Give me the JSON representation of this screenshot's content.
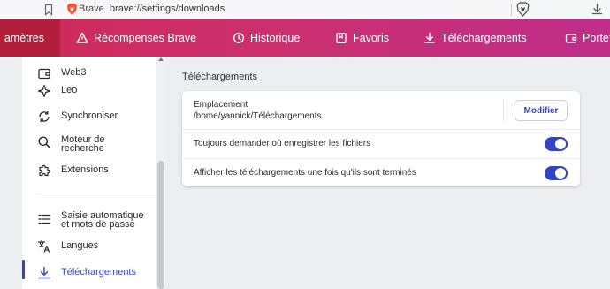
{
  "addressbar": {
    "brave_label": "Brave",
    "url": "brave://settings/downloads"
  },
  "tabs": [
    {
      "label": "amètres",
      "icon": "gear-icon",
      "active": true
    },
    {
      "label": "Récompenses Brave",
      "icon": "rewards-triangle-icon"
    },
    {
      "label": "Historique",
      "icon": "history-icon"
    },
    {
      "label": "Favoris",
      "icon": "bookmarks-icon"
    },
    {
      "label": "Téléchargements",
      "icon": "download-icon"
    },
    {
      "label": "Portef",
      "icon": "wallet-icon"
    }
  ],
  "sidebar": {
    "items": [
      {
        "label": "Web3",
        "icon": "wallet-icon"
      },
      {
        "label": "Leo",
        "icon": "sparkle-icon"
      },
      {
        "label": "Synchroniser",
        "icon": "sync-icon"
      },
      {
        "label": "Moteur de",
        "label2": "recherche",
        "icon": "search-icon"
      },
      {
        "label": "Extensions",
        "icon": "puzzle-icon"
      },
      {
        "label": "Saisie automatique",
        "label2": "et mots de passe",
        "icon": "autofill-list-icon"
      },
      {
        "label": "Langues",
        "icon": "translate-icon"
      },
      {
        "label": "Téléchargements",
        "icon": "download-icon",
        "active": true
      }
    ]
  },
  "main": {
    "section_title": "Téléchargements",
    "location_label": "Emplacement",
    "location_path": "/home/yannick/Téléchargements",
    "modify_button": "Modifier",
    "settings": [
      {
        "label": "Toujours demander où enregistrer les fichiers",
        "enabled": true
      },
      {
        "label": "Afficher les téléchargements une fois qu'ils sont terminés",
        "enabled": true
      }
    ]
  },
  "colors": {
    "accent": "#3442c8",
    "tabbar_start": "#cf2a58",
    "tabbar_end": "#c02e8a",
    "active_tab": "#b21f3a"
  }
}
